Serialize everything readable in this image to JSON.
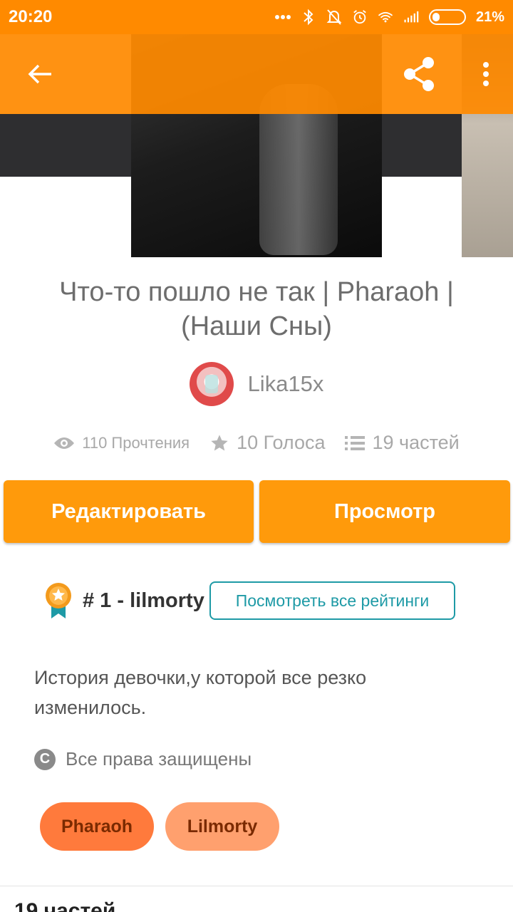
{
  "status_bar": {
    "time": "20:20",
    "battery_percent": "21%",
    "icons": [
      "more-dots-icon",
      "bluetooth-icon",
      "mute-icon",
      "alarm-icon",
      "wifi-icon",
      "signal-icon",
      "battery-icon"
    ]
  },
  "app_bar": {
    "icons": [
      "back-arrow-icon",
      "share-icon",
      "more-vert-icon"
    ]
  },
  "story": {
    "title": "Что-то пошло не так | Pharaoh | (Наши Сны)",
    "author": "Lika15x",
    "stats": {
      "reads": "110 Прочтения",
      "votes": "10 Голоса",
      "parts": "19 частей"
    },
    "description": "История девочки,у которой все резко изменилось.",
    "copyright": "Все права защищены",
    "tags": [
      "Pharaoh",
      "Lilmorty"
    ]
  },
  "actions": {
    "edit_label": "Редактировать",
    "view_label": "Просмотр"
  },
  "ranking": {
    "text": "# 1 - lilmorty",
    "button_label": "Посмотреть все рейтинги"
  },
  "parts_section_cut": "19 частей",
  "colors": {
    "accent": "#ff8a00",
    "button": "#ff9a0b",
    "teal": "#1e9aa6",
    "tag_1": "#ff7a3c",
    "tag_2": "#ffa06e"
  }
}
